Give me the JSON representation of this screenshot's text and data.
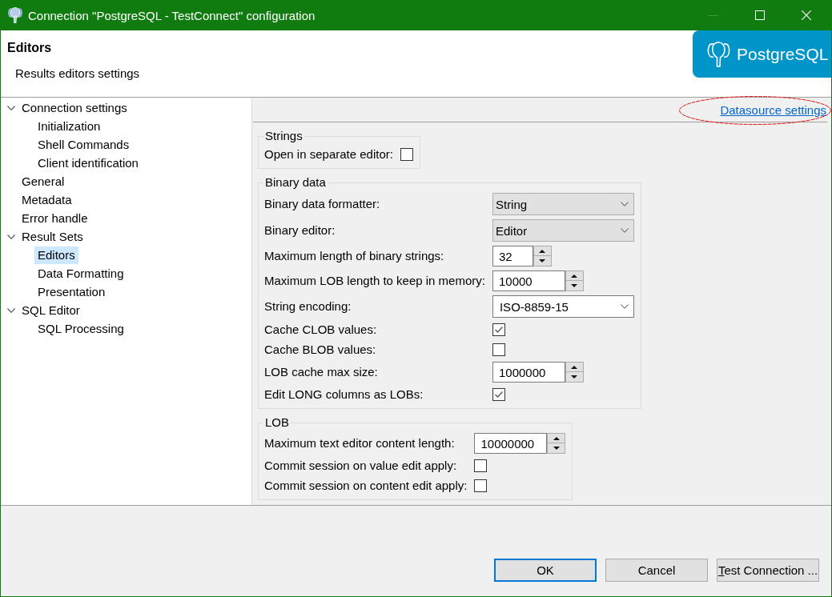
{
  "window": {
    "title": "Connection \"PostgreSQL - TestConnect\" configuration",
    "controls": [
      {
        "kind": "minimize",
        "disabled": true
      },
      {
        "kind": "maximize",
        "disabled": false
      },
      {
        "kind": "close",
        "disabled": false
      }
    ]
  },
  "header": {
    "title": "Editors",
    "subtitle": "Results editors settings",
    "logo_text": "PostgreSQL"
  },
  "tree": [
    {
      "label": "Connection settings",
      "expanded": true,
      "selected": false,
      "children": [
        {
          "label": "Initialization",
          "selected": false
        },
        {
          "label": "Shell Commands",
          "selected": false
        },
        {
          "label": "Client identification",
          "selected": false
        }
      ]
    },
    {
      "label": "General",
      "selected": false
    },
    {
      "label": "Metadata",
      "selected": false
    },
    {
      "label": "Error handle",
      "selected": false
    },
    {
      "label": "Result Sets",
      "expanded": true,
      "selected": false,
      "children": [
        {
          "label": "Editors",
          "selected": true
        },
        {
          "label": "Data Formatting",
          "selected": false
        },
        {
          "label": "Presentation",
          "selected": false
        }
      ]
    },
    {
      "label": "SQL Editor",
      "expanded": true,
      "selected": false,
      "children": [
        {
          "label": "SQL Processing",
          "selected": false
        }
      ]
    }
  ],
  "link": {
    "label": "Datasource settings",
    "highlighted": true
  },
  "groups": [
    {
      "title": "Strings",
      "rows": [
        {
          "kind": "checkbox",
          "label": "Open in separate editor:",
          "checked": false
        }
      ]
    },
    {
      "title": "Binary data",
      "rows": [
        {
          "kind": "combo",
          "label": "Binary data formatter:",
          "value": "String",
          "editable": false
        },
        {
          "kind": "combo",
          "label": "Binary editor:",
          "value": "Editor",
          "editable": false
        },
        {
          "kind": "spinner",
          "label": "Maximum length of binary strings:",
          "value": "32"
        },
        {
          "kind": "spinner",
          "label": "Maximum LOB length to keep in memory:",
          "value": "10000"
        },
        {
          "kind": "combo",
          "label": "String encoding:",
          "value": "ISO-8859-15",
          "editable": true
        },
        {
          "kind": "checkbox",
          "label": "Cache CLOB values:",
          "checked": true
        },
        {
          "kind": "checkbox",
          "label": "Cache BLOB values:",
          "checked": false
        },
        {
          "kind": "spinner",
          "label": "LOB cache max size:",
          "value": "1000000"
        },
        {
          "kind": "checkbox",
          "label": "Edit LONG columns as LOBs:",
          "checked": true
        }
      ]
    },
    {
      "title": "LOB",
      "rows": [
        {
          "kind": "spinner",
          "label": "Maximum text editor content length:",
          "value": "10000000"
        },
        {
          "kind": "checkbox",
          "label": "Commit session on value edit apply:",
          "checked": false
        },
        {
          "kind": "checkbox",
          "label": "Commit session on content edit apply:",
          "checked": false
        }
      ]
    }
  ],
  "buttons": [
    {
      "label": "OK",
      "focused": true,
      "mnemonic": false
    },
    {
      "label": "Cancel",
      "focused": false,
      "mnemonic": false
    },
    {
      "label": "Test Connection ...",
      "focused": false,
      "mnemonic": true
    }
  ]
}
